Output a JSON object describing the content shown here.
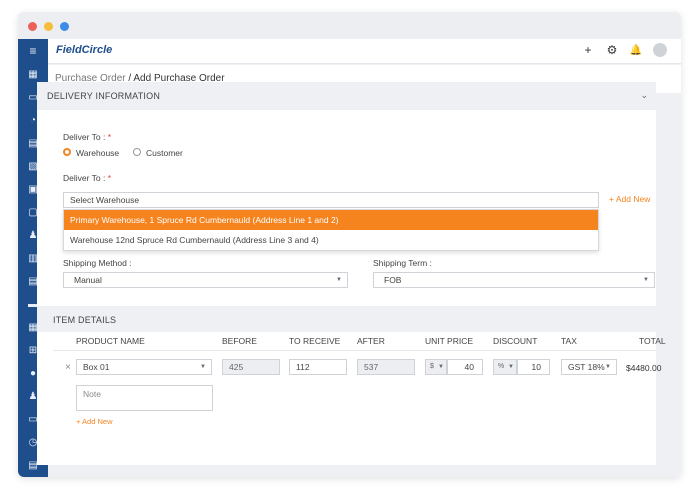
{
  "window": {
    "dots": [
      "#ee5f58",
      "#f6bd3b",
      "#3f8be8"
    ]
  },
  "app": {
    "brand": "FieldCircle"
  },
  "topbar": {
    "add_icon": "+",
    "settings_icon": "⚙",
    "bell_icon": "🔔"
  },
  "breadcrumb": {
    "parent": "Purchase Order",
    "separator": "/",
    "current": "Add Purchase Order"
  },
  "delivery": {
    "title": "DELIVERY INFORMATION",
    "deliver_to_label": "Deliver To :",
    "required_mark": "*",
    "radio_options": [
      "Warehouse",
      "Customer"
    ],
    "selected_radio": "Warehouse",
    "deliver_to_label_2": "Deliver To :",
    "select_placeholder": "Select Warehouse",
    "add_new": "+ Add New",
    "dropdown_options": [
      "Primary Warehouse, 1 Spruce Rd Cumbernauld (Address Line 1 and 2)",
      "Warehouse 12nd Spruce Rd Cumbernauld (Address Line 3 and 4)"
    ],
    "highlighted_option_index": 0,
    "shipping_method_label": "Shipping Method :",
    "shipping_method_value": "Manual",
    "shipping_term_label": "Shipping Term :",
    "shipping_term_value": "FOB"
  },
  "items": {
    "title": "ITEM DETAILS",
    "columns": [
      "PRODUCT NAME",
      "BEFORE",
      "TO RECEIVE",
      "AFTER",
      "UNIT PRICE",
      "DISCOUNT",
      "TAX",
      "TOTAL"
    ],
    "row": {
      "remove_icon": "×",
      "product": "Box 01",
      "before": "425",
      "to_receive": "112",
      "after": "537",
      "price_currency": "$",
      "unit_price": "40",
      "discount_type": "%",
      "discount": "10",
      "tax": "GST 18%",
      "total": "$4480.00",
      "note_placeholder": "Note",
      "add_new": "+ Add New"
    }
  },
  "colors": {
    "accent": "#f5841f",
    "sidebar": "#1f4e8c"
  }
}
